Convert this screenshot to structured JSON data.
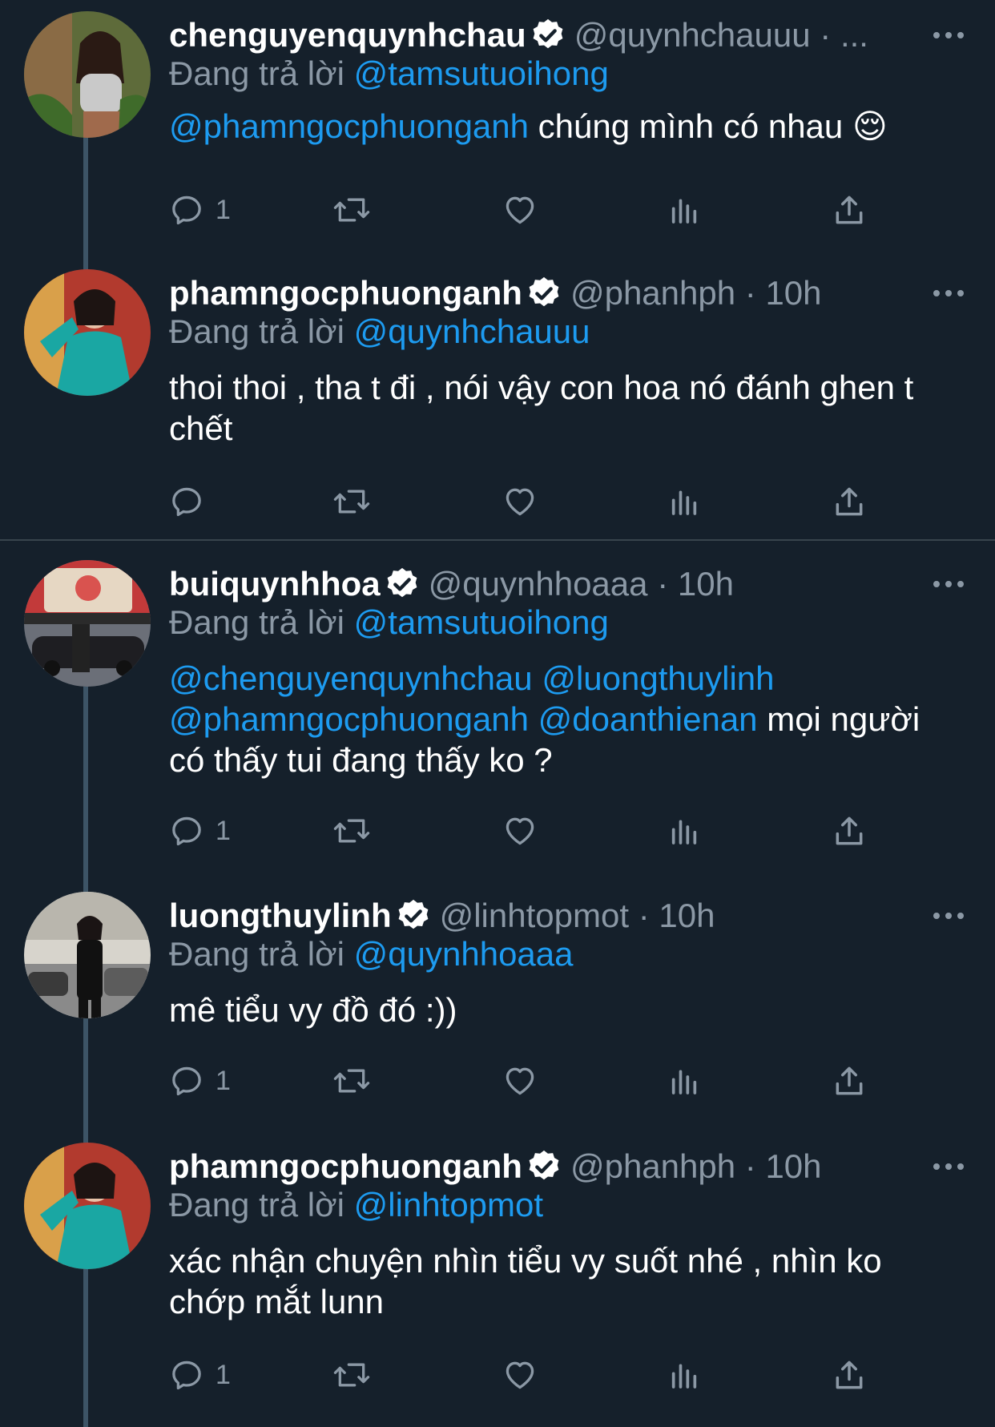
{
  "reply_prefix": "Đang trả lời",
  "tweets": [
    {
      "name": "chenguyenquynhchau",
      "handle": "@quynhchauuu",
      "dot": "·",
      "time": "...",
      "reply_to": "@tamsutuoihong",
      "body": [
        {
          "type": "mention",
          "text": "@phamngocphuonganh"
        },
        {
          "type": "text",
          "text": " chúng mình có nhau "
        },
        {
          "type": "emoji",
          "text": "😌"
        }
      ],
      "reply_count": "1"
    },
    {
      "name": "phamngocphuonganh",
      "handle": "@phanhph",
      "dot": "·",
      "time": "10h",
      "reply_to": "@quynhchauuu",
      "body": [
        {
          "type": "text",
          "text": "thoi thoi , tha t đi , nói vậy con hoa nó đánh ghen t chết"
        }
      ],
      "reply_count": ""
    },
    {
      "name": "buiquynhhoa",
      "handle": "@quynhhoaaa",
      "dot": "·",
      "time": "10h",
      "reply_to": "@tamsutuoihong",
      "body": [
        {
          "type": "mention",
          "text": "@chenguyenquynhchau"
        },
        {
          "type": "text",
          "text": " "
        },
        {
          "type": "mention",
          "text": "@luongthuylinh"
        },
        {
          "type": "text",
          "text": " "
        },
        {
          "type": "mention",
          "text": "@phamngocphuonganh"
        },
        {
          "type": "text",
          "text": " "
        },
        {
          "type": "mention",
          "text": "@doanthienan"
        },
        {
          "type": "text",
          "text": " mọi người có thấy tui đang thấy ko ?"
        }
      ],
      "reply_count": "1"
    },
    {
      "name": "luongthuylinh",
      "handle": "@linhtopmot",
      "dot": "·",
      "time": "10h",
      "reply_to": "@quynhhoaaa",
      "body": [
        {
          "type": "text",
          "text": "mê tiểu vy đồ đó :))"
        }
      ],
      "reply_count": "1"
    },
    {
      "name": "phamngocphuonganh",
      "handle": "@phanhph",
      "dot": "·",
      "time": "10h",
      "reply_to": "@linhtopmot",
      "body": [
        {
          "type": "text",
          "text": "xác nhận chuyện nhìn tiểu vy suốt nhé , nhìn ko chớp mắt lunn"
        }
      ],
      "reply_count": "1"
    }
  ],
  "icons": {
    "reply": "reply-icon",
    "retweet": "retweet-icon",
    "like": "heart-icon",
    "views": "views-icon",
    "share": "share-icon",
    "more": "more-icon",
    "verified": "verified-badge-icon"
  },
  "colors": {
    "background": "#15202b",
    "mention": "#1d9bf0",
    "secondary_text": "#8b98a5"
  }
}
